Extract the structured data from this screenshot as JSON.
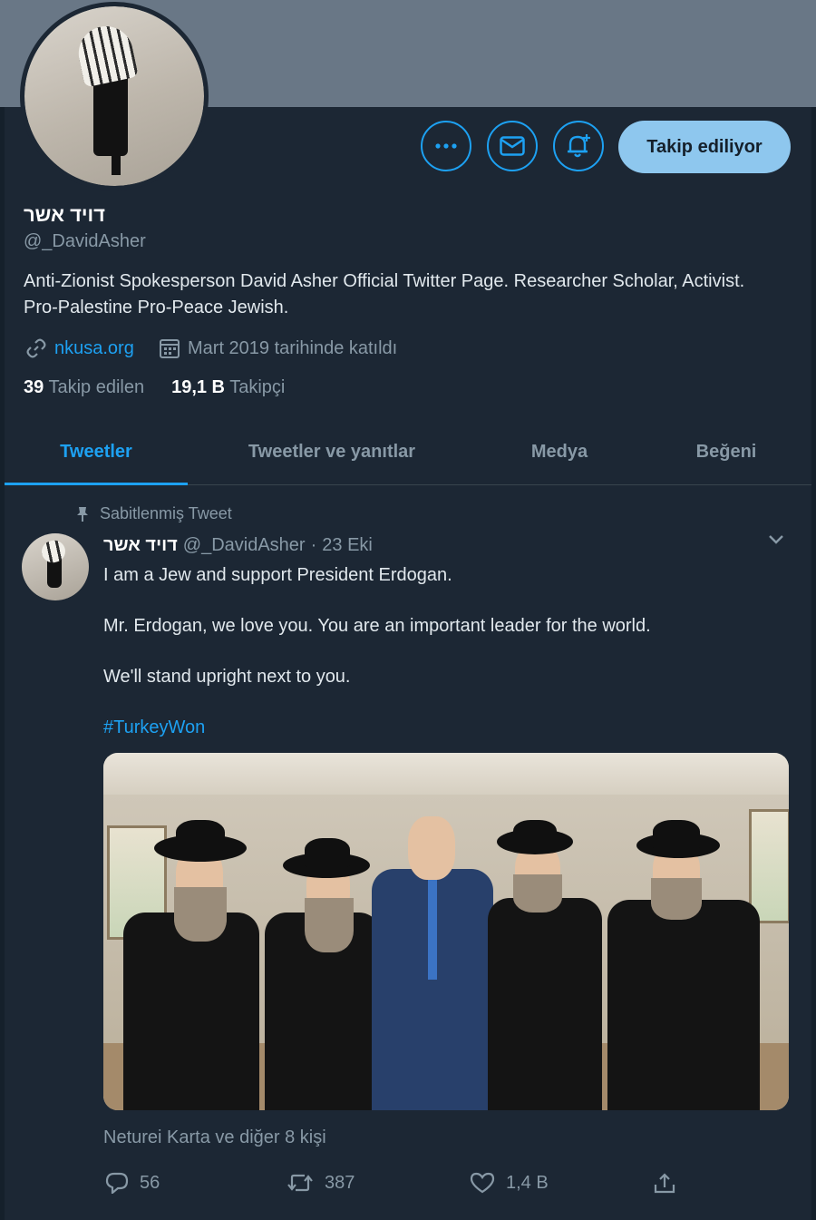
{
  "profile": {
    "name": "דויד אשר",
    "handle": "@_DavidAsher",
    "bio": "Anti-Zionist Spokesperson David Asher Official Twitter Page. Researcher Scholar, Activist. Pro-Palestine Pro-Peace Jewish.",
    "website": "nkusa.org",
    "joined": "Mart 2019 tarihinde katıldı",
    "following_count": "39",
    "following_label": "Takip edilen",
    "followers_count": "19,1 B",
    "followers_label": "Takipçi"
  },
  "actions_bar": {
    "more_icon": "more-icon",
    "message_icon": "envelope-icon",
    "notify_icon": "bell-plus-icon",
    "follow_label": "Takip ediliyor"
  },
  "tabs": [
    {
      "label": "Tweetler",
      "active": true
    },
    {
      "label": "Tweetler ve yanıtlar",
      "active": false
    },
    {
      "label": "Medya",
      "active": false
    },
    {
      "label": "Beğeni",
      "active": false
    }
  ],
  "tweet": {
    "pinned_label": "Sabitlenmiş Tweet",
    "author_name": "דויד אשר",
    "author_handle": "@_DavidAsher",
    "separator": "·",
    "date": "23 Eki",
    "line1": "I am a Jew and support President Erdogan.",
    "line2": "Mr. Erdogan, we love you. You are an important leader for the world.",
    "line3": "We'll stand upright next to you.",
    "hashtag": "#TurkeyWon",
    "liked_by": "Neturei Karta ve diğer 8 kişi",
    "reply_count": "56",
    "retweet_count": "387",
    "like_count": "1,4 B"
  },
  "colors": {
    "background": "#15202b",
    "panel": "#1c2734",
    "accent": "#1da1f2",
    "muted": "#8899a6"
  }
}
